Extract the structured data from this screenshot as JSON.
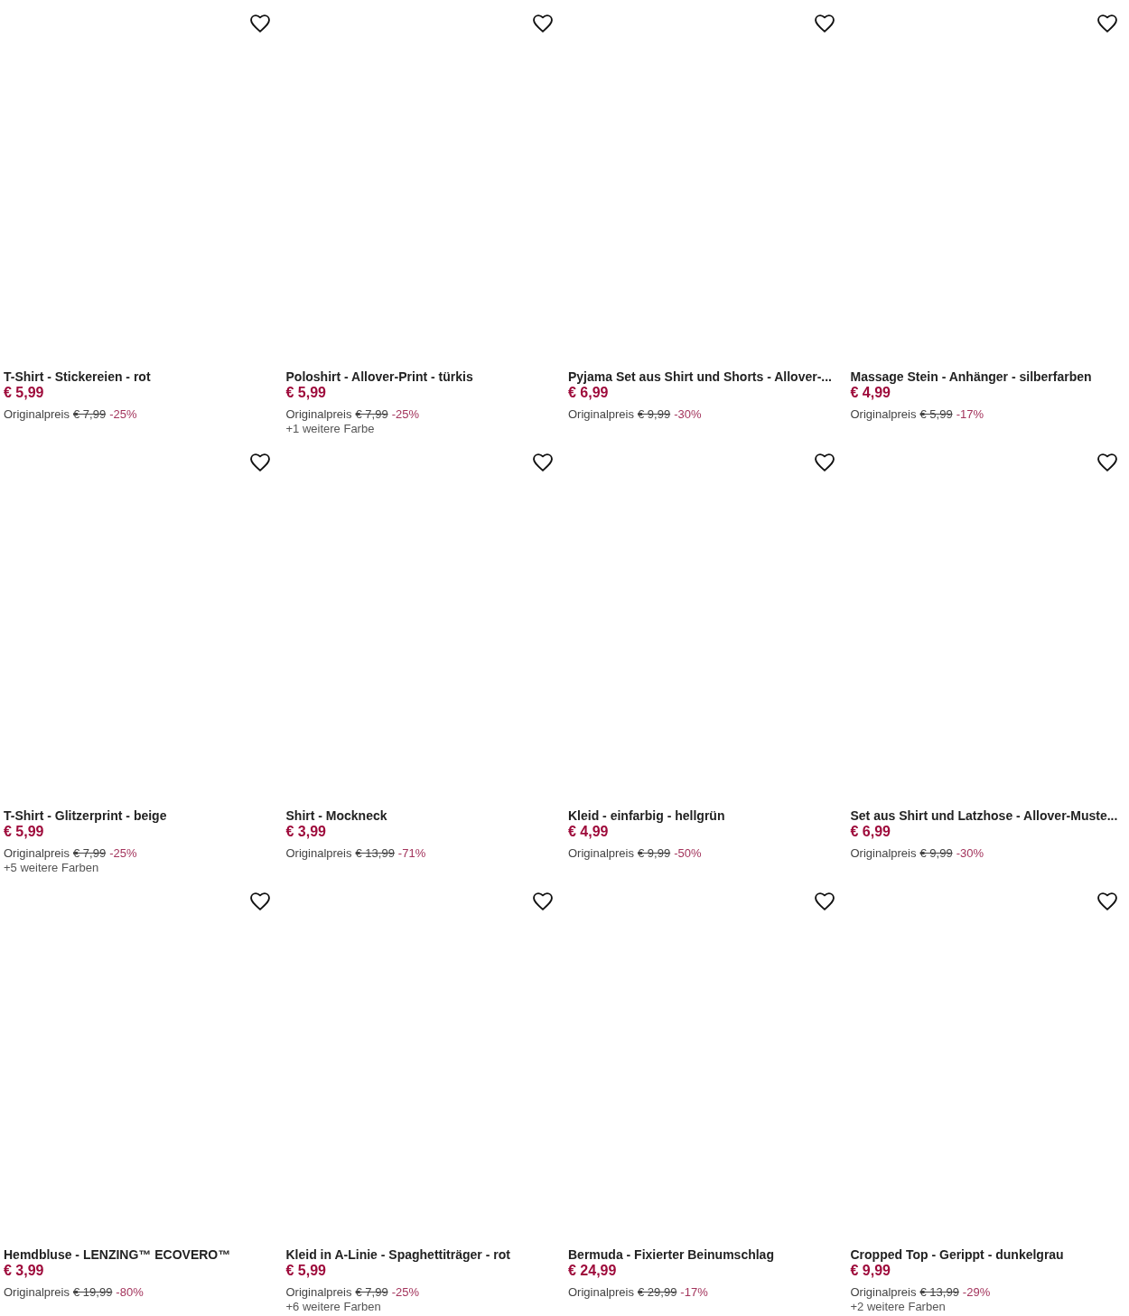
{
  "products": [
    {
      "favorite": false,
      "title": "T-Shirt - Stickereien - rot",
      "price": "€ 5,99",
      "original_label": "Originalpreis",
      "original_price": "€ 7,99",
      "discount": "-25%"
    },
    {
      "favorite": false,
      "title": "Poloshirt - Allover-Print - türkis",
      "price": "€ 5,99",
      "original_label": "Originalpreis",
      "original_price": "€ 7,99",
      "discount": "-25%",
      "more_colors": "+1 weitere Farbe"
    },
    {
      "favorite": false,
      "title": "Pyjama Set aus Shirt und Shorts - Allover-...",
      "price": "€ 6,99",
      "original_label": "Originalpreis",
      "original_price": "€ 9,99",
      "discount": "-30%"
    },
    {
      "favorite": false,
      "title": "Massage Stein - Anhänger - silberfarben",
      "price": "€ 4,99",
      "original_label": "Originalpreis",
      "original_price": "€ 5,99",
      "discount": "-17%"
    },
    {
      "favorite": false,
      "title": "T-Shirt - Glitzerprint - beige",
      "price": "€ 5,99",
      "original_label": "Originalpreis",
      "original_price": "€ 7,99",
      "discount": "-25%",
      "more_colors": "+5 weitere Farben"
    },
    {
      "favorite": false,
      "title": "Shirt - Mockneck",
      "price": "€ 3,99",
      "original_label": "Originalpreis",
      "original_price": "€ 13,99",
      "discount": "-71%"
    },
    {
      "favorite": false,
      "title": "Kleid - einfarbig - hellgrün",
      "price": "€ 4,99",
      "original_label": "Originalpreis",
      "original_price": "€ 9,99",
      "discount": "-50%"
    },
    {
      "favorite": false,
      "title": "Set aus Shirt und Latzhose - Allover-Muste...",
      "price": "€ 6,99",
      "original_label": "Originalpreis",
      "original_price": "€ 9,99",
      "discount": "-30%"
    },
    {
      "favorite": false,
      "title": "Hemdbluse - LENZING™ ECOVERO™",
      "price": "€ 3,99",
      "original_label": "Originalpreis",
      "original_price": "€ 19,99",
      "discount": "-80%"
    },
    {
      "favorite": false,
      "title": "Kleid in A-Linie - Spaghettiträger - rot",
      "price": "€ 5,99",
      "original_label": "Originalpreis",
      "original_price": "€ 7,99",
      "discount": "-25%",
      "more_colors": "+6 weitere Farben"
    },
    {
      "favorite": false,
      "title": "Bermuda - Fixierter Beinumschlag",
      "price": "€ 24,99",
      "original_label": "Originalpreis",
      "original_price": "€ 29,99",
      "discount": "-17%"
    },
    {
      "favorite": false,
      "title": "Cropped Top - Gerippt - dunkelgrau",
      "price": "€ 9,99",
      "original_label": "Originalpreis",
      "original_price": "€ 13,99",
      "discount": "-29%",
      "more_colors": "+2 weitere Farben"
    }
  ]
}
